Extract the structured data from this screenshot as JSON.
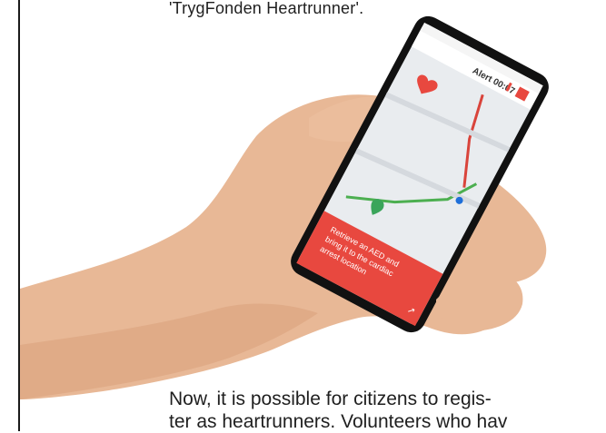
{
  "caption_top": "'TrygFonden Heartrunner'.",
  "phone": {
    "alert_label": "Alert 00:07",
    "banner_line1": "Retrieve an AED and",
    "banner_line2": "bring it to the cardiac",
    "banner_line3": "arrest location",
    "colors": {
      "accent": "#e8483f",
      "screen_bg": "#e9ecef",
      "route_green": "#4caf50",
      "route_red": "#d9443b"
    }
  },
  "body_text": {
    "line1": "Now, it is possible for citizens to regis-",
    "line2": "ter as heartrunners. Volunteers who hav"
  }
}
